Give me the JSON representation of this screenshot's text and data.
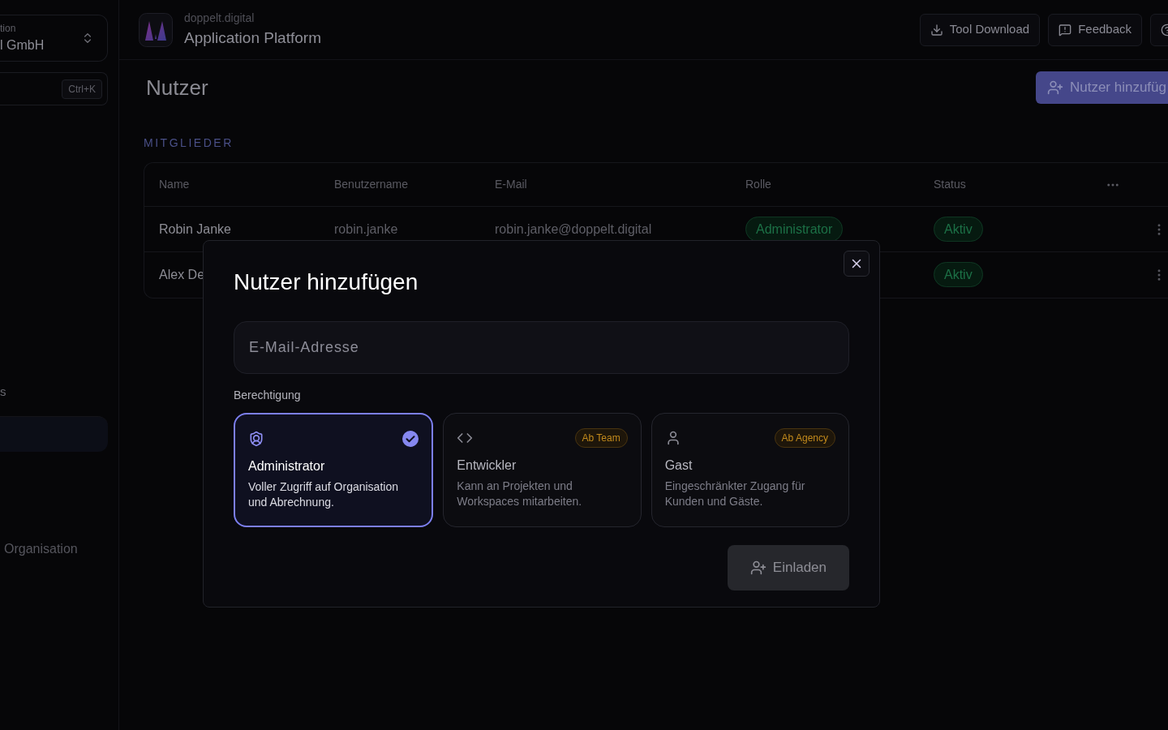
{
  "sidebar": {
    "org_label": "tion",
    "org_name": "l GmbH",
    "shortcut": "Ctrl+K",
    "items": [
      {
        "label": "s",
        "selected": false
      },
      {
        "selected": true
      }
    ],
    "footer_link": "Organisation"
  },
  "header": {
    "brand": "doppelt.digital",
    "title": "Application Platform",
    "buttons": [
      {
        "kind": "download",
        "label": "Tool Download"
      },
      {
        "kind": "feedback",
        "label": "Feedback"
      },
      {
        "kind": "help"
      }
    ]
  },
  "page": {
    "title": "Nutzer",
    "add_button": "Nutzer hinzufüg",
    "section": "MITGLIEDER",
    "table": {
      "columns": [
        "Name",
        "Benutzername",
        "E-Mail",
        "Rolle",
        "Status"
      ],
      "rows": [
        {
          "name": "Robin Janke",
          "username": "robin.janke",
          "email": "robin.janke@doppelt.digital",
          "role": "Administrator",
          "status": "Aktiv"
        },
        {
          "name": "Alex De",
          "status": "Aktiv"
        }
      ]
    }
  },
  "modal": {
    "title": "Nutzer hinzufügen",
    "email_placeholder": "E-Mail-Adresse",
    "permission_label": "Berechtigung",
    "roles": [
      {
        "kind": "admin",
        "name": "Administrator",
        "description": "Voller Zugriff auf Organisation und Abrechnung.",
        "selected": true
      },
      {
        "kind": "developer",
        "name": "Entwickler",
        "description": "Kann an Projekten und Workspaces mitarbeiten.",
        "badge": "Ab Team",
        "selected": false
      },
      {
        "kind": "guest",
        "name": "Gast",
        "description": "Eingeschränkter Zugang für Kunden und Gäste.",
        "badge": "Ab Agency",
        "selected": false
      }
    ],
    "submit": {
      "label": "Einladen",
      "disabled": true
    }
  }
}
